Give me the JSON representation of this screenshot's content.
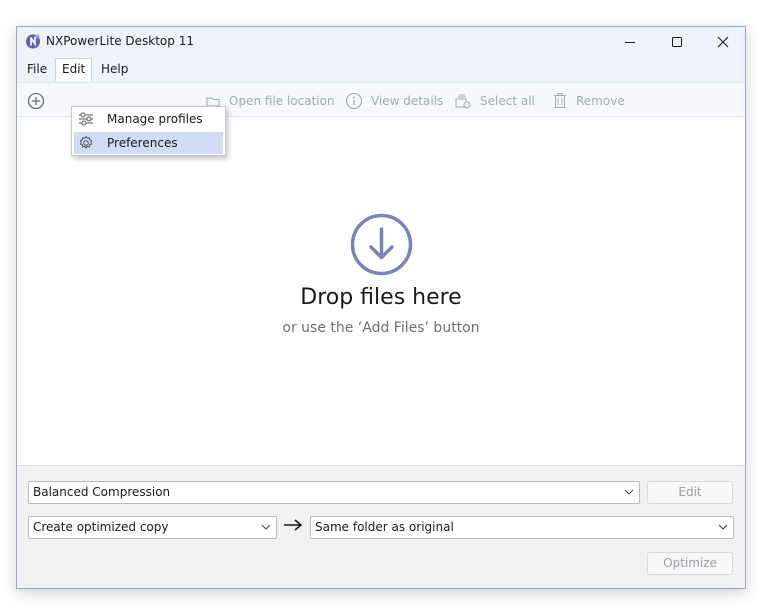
{
  "window": {
    "title": "NXPowerLite Desktop 11"
  },
  "menubar": {
    "file": "File",
    "edit": "Edit",
    "help": "Help"
  },
  "edit_menu": {
    "items": [
      {
        "label": "Manage profiles",
        "icon": "sliders-icon",
        "highlighted": false
      },
      {
        "label": "Preferences",
        "icon": "gear-icon",
        "highlighted": true
      }
    ]
  },
  "toolbar": {
    "open_location": "Open file location",
    "view_details": "View details",
    "select_all": "Select all",
    "remove": "Remove"
  },
  "drop": {
    "title": "Drop files here",
    "subtitle": "or use the ‘Add Files’ button"
  },
  "settings": {
    "profile": "Balanced Compression",
    "edit_label": "Edit",
    "mode": "Create optimized copy",
    "destination": "Same folder as original",
    "optimize_label": "Optimize"
  },
  "colors": {
    "accent": "#7c83b8",
    "titlebar": "#eef2f9",
    "highlight": "#cfdcf3",
    "disabled_text": "#a3a8b4"
  }
}
